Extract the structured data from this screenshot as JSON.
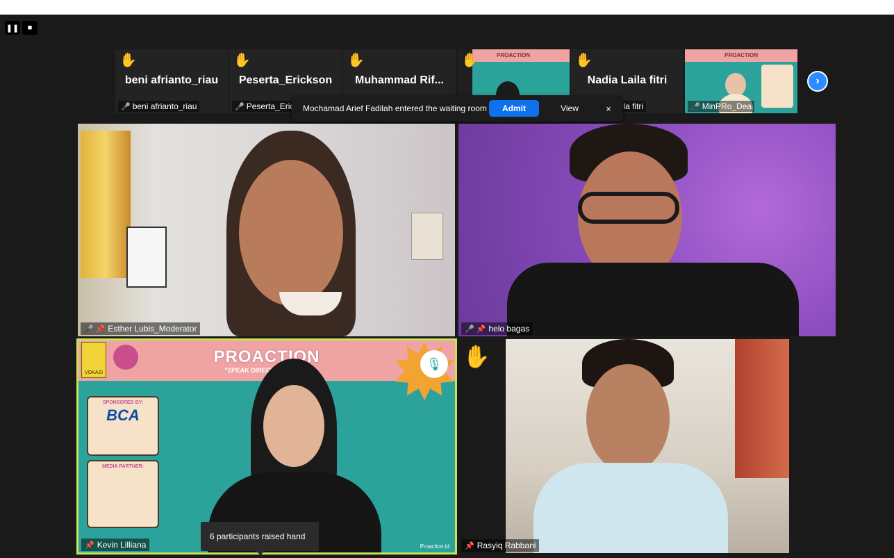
{
  "recording": {
    "pause_icon": "pause-icon",
    "stop_icon": "stop-icon"
  },
  "thumbnails": [
    {
      "big": "beni afrianto_riau",
      "name": "beni afrianto_riau",
      "hand": true
    },
    {
      "big": "Peserta_Erickson",
      "name": "Peserta_Erickson",
      "hand": true
    },
    {
      "big": "Muhammad  Rif...",
      "name": "",
      "hand": true
    },
    {
      "big": "",
      "name": "",
      "hand": true,
      "slide_title": "PROACTION"
    },
    {
      "big": "Nadia Laila fitri",
      "name": "Nadia Laila fitri",
      "hand": true
    },
    {
      "big": "",
      "name": "MinPRo_Dea",
      "hand": false,
      "slide_title": "PROACTION"
    }
  ],
  "waiting_room": {
    "message": "Mochamad Arief Fadilah entered the waiting room",
    "admit_label": "Admit",
    "view_label": "View",
    "close_label": "×"
  },
  "tiles": {
    "esther": {
      "name": "Esther Lubis_Moderator"
    },
    "helo": {
      "name": "helo bagas"
    },
    "kevin": {
      "name": "Kevin Lilliana",
      "slide_title": "PROACTION",
      "slide_subtitle": "\"SPEAK DIRECTLY ... CTLY\"",
      "sponsored": "SPONSORED BY:",
      "sponsor": "BCA",
      "media": "MEDIA PARTNER:",
      "handle": "Proaction.id",
      "badge": "VOKASI"
    },
    "rasyiq": {
      "name": "Rasyiq Rabbani"
    }
  },
  "tooltip": "6 participants raised hand",
  "colors": {
    "accent": "#0e72ed",
    "active_border": "#c8e35a",
    "slide_teal": "#2ba39a",
    "slide_pink": "#f0a3a3",
    "mic_off": "#e03c31"
  }
}
